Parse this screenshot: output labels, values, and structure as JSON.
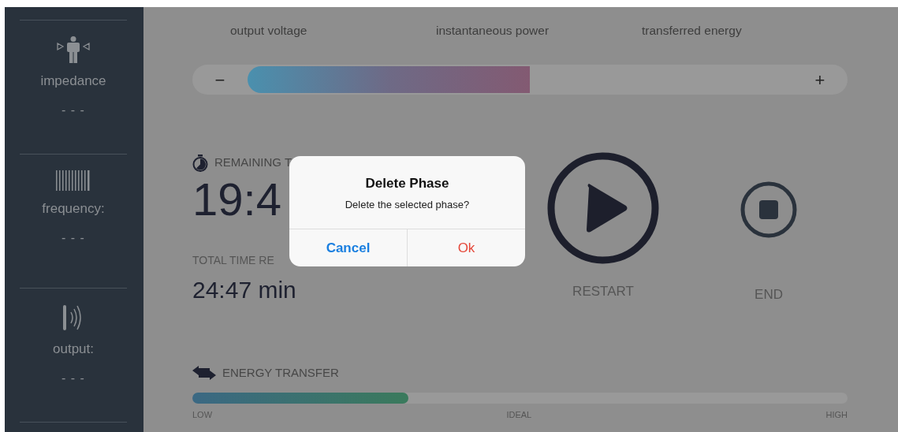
{
  "sidebar": {
    "items": [
      {
        "kind": "impedance",
        "label": "impedance",
        "value": "- - -"
      },
      {
        "kind": "frequency",
        "label": "frequency:",
        "value": "- - -"
      },
      {
        "kind": "output",
        "label": "output:",
        "value": "- - -"
      }
    ]
  },
  "metrics": [
    "output voltage",
    "instantaneous power",
    "transferred energy"
  ],
  "power_slider": {
    "minus": "−",
    "plus": "+"
  },
  "timer": {
    "remaining_label": "REMAINING T",
    "remaining_value": "19:4",
    "total_label": "TOTAL TIME RE",
    "total_value": "24:47 min"
  },
  "controls": [
    {
      "kind": "play",
      "label": "RESTART"
    },
    {
      "kind": "stop",
      "label": "END"
    }
  ],
  "energy_transfer": {
    "title": "ENERGY  TRANSFER",
    "level": 0.33,
    "scale": [
      "LOW",
      "IDEAL",
      "HIGH"
    ]
  },
  "dialog": {
    "title": "Delete Phase",
    "message": "Delete the selected phase?",
    "buttons": [
      {
        "label": "Cancel",
        "kind": "cancel"
      },
      {
        "label": "Ok",
        "kind": "destructive"
      }
    ]
  }
}
